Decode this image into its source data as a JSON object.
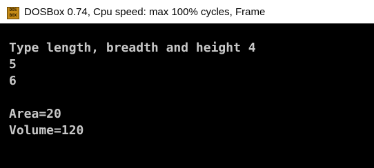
{
  "window": {
    "icon_text_top": "DOS",
    "icon_text_bottom": "BOX",
    "title": "DOSBox 0.74, Cpu speed: max 100% cycles, Frame"
  },
  "console": {
    "lines": [
      "Type length, breadth and height 4",
      "5",
      "6",
      "",
      "Area=20",
      "Volume=120"
    ]
  }
}
